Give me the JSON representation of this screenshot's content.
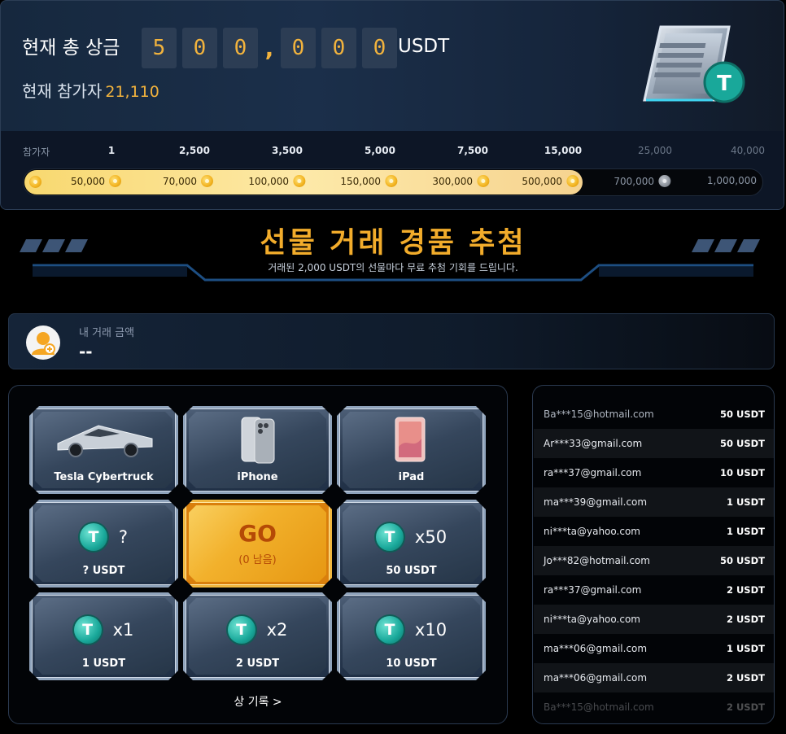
{
  "prize": {
    "title": "현재 총 상금",
    "digits": [
      "5",
      "0",
      "0",
      ",",
      "0",
      "0",
      "0"
    ],
    "unit": "USDT",
    "participants_label": "현재 참가자",
    "participants_count": "21,110"
  },
  "tiers": {
    "header": "참가자",
    "thresholds": [
      {
        "label": "1",
        "reached": true
      },
      {
        "label": "2,500",
        "reached": true
      },
      {
        "label": "3,500",
        "reached": true
      },
      {
        "label": "5,000",
        "reached": true
      },
      {
        "label": "7,500",
        "reached": true
      },
      {
        "label": "15,000",
        "reached": true
      },
      {
        "label": "25,000",
        "reached": false
      },
      {
        "label": "40,000",
        "reached": false
      }
    ],
    "rewards": [
      {
        "label": "50,000",
        "reached": true
      },
      {
        "label": "70,000",
        "reached": true
      },
      {
        "label": "100,000",
        "reached": true
      },
      {
        "label": "150,000",
        "reached": true
      },
      {
        "label": "300,000",
        "reached": true
      },
      {
        "label": "500,000",
        "reached": true
      },
      {
        "label": "700,000",
        "reached": false
      },
      {
        "label": "1,000,000",
        "reached": false
      }
    ]
  },
  "banner": {
    "title": "선물 거래 경품 추첨",
    "subtitle": "거래된 2,000 USDT의 선물마다 무료 추첨 기회를 드립니다."
  },
  "trade": {
    "label": "내 거래 금액",
    "value": "--"
  },
  "lottery": {
    "tiles": [
      {
        "label": "Tesla Cybertruck",
        "icon": "cybertruck-image"
      },
      {
        "label": "iPhone",
        "icon": "iphone-image"
      },
      {
        "label": "iPad",
        "icon": "ipad-image"
      },
      {
        "label": "? USDT",
        "mult": "?",
        "icon": "tether-icon"
      },
      {
        "label": "GO",
        "sub": "(0 남음)"
      },
      {
        "label": "50 USDT",
        "mult": "x50",
        "icon": "tether-icon"
      },
      {
        "label": "1 USDT",
        "mult": "x1",
        "icon": "tether-icon"
      },
      {
        "label": "2 USDT",
        "mult": "x2",
        "icon": "tether-icon"
      },
      {
        "label": "10 USDT",
        "mult": "x10",
        "icon": "tether-icon"
      }
    ],
    "history_link": "상 기록 >"
  },
  "winners": [
    {
      "email": "Ba***15@hotmail.com",
      "amount": "50 USDT"
    },
    {
      "email": "Ar***33@gmail.com",
      "amount": "50 USDT"
    },
    {
      "email": "ra***37@gmail.com",
      "amount": "10 USDT"
    },
    {
      "email": "ma***39@gmail.com",
      "amount": "1 USDT"
    },
    {
      "email": "ni***ta@yahoo.com",
      "amount": "1 USDT"
    },
    {
      "email": "Jo***82@hotmail.com",
      "amount": "50 USDT"
    },
    {
      "email": "ra***37@gmail.com",
      "amount": "2 USDT"
    },
    {
      "email": "ni***ta@yahoo.com",
      "amount": "2 USDT"
    },
    {
      "email": "ma***06@gmail.com",
      "amount": "1 USDT"
    },
    {
      "email": "ma***06@gmail.com",
      "amount": "2 USDT"
    },
    {
      "email": "Ba***15@hotmail.com",
      "amount": "2 USDT"
    }
  ],
  "colors": {
    "accent_gold": "#f2b33d",
    "banner_gold": "#f2ac2b",
    "tether_teal": "#19a89a",
    "go_orange": "#f2b12c"
  }
}
